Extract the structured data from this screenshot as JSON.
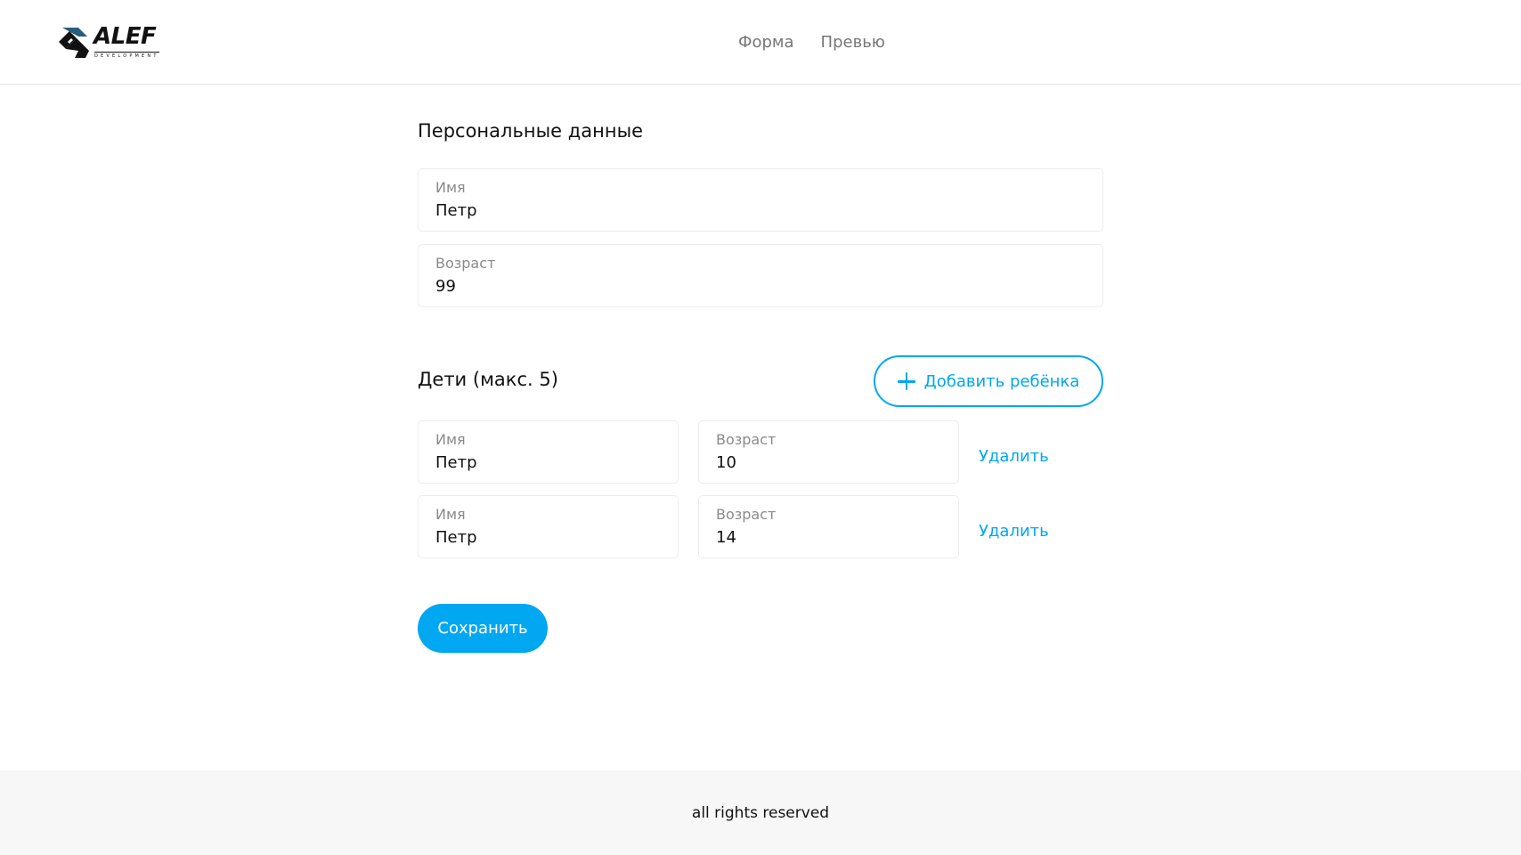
{
  "header": {
    "logo_text": "ALEF",
    "logo_subtext": "DEVELOPMENT",
    "nav": [
      {
        "label": "Форма"
      },
      {
        "label": "Превью"
      }
    ]
  },
  "personal": {
    "title": "Персональные данные",
    "name_label": "Имя",
    "name_value": "Петр",
    "age_label": "Возраст",
    "age_value": "99"
  },
  "children": {
    "title": "Дети (макс. 5)",
    "add_button_label": "Добавить ребёнка",
    "items": [
      {
        "name_label": "Имя",
        "name_value": "Петр",
        "age_label": "Возраст",
        "age_value": "10",
        "delete_label": "Удалить"
      },
      {
        "name_label": "Имя",
        "name_value": "Петр",
        "age_label": "Возраст",
        "age_value": "14",
        "delete_label": "Удалить"
      }
    ]
  },
  "save_label": "Сохранить",
  "footer": {
    "text": "all rights reserved"
  },
  "colors": {
    "accent": "#01a7f0",
    "label": "#8a8a8a",
    "border": "#ededed",
    "footer_bg": "#f7f7f7"
  },
  "icons": {
    "logo": "alef-logo-icon",
    "add": "plus-icon"
  }
}
